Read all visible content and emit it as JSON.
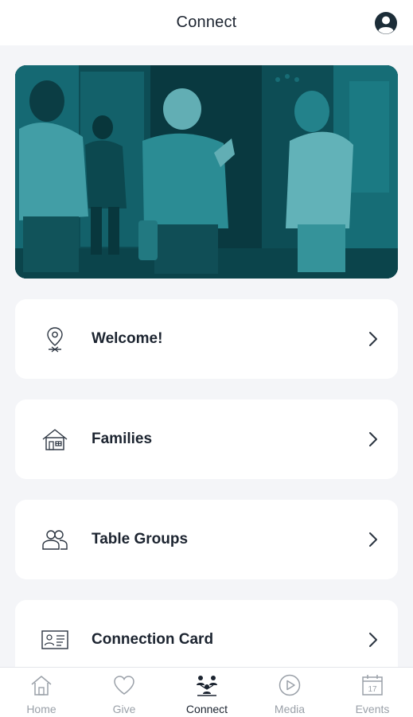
{
  "header": {
    "title": "Connect",
    "profile_icon": "user-circle-icon"
  },
  "hero": {
    "image": "people-greeting-at-church-entrance-photo",
    "tint": "#0e6f78"
  },
  "menu": [
    {
      "label": "Welcome!",
      "icon": "map-pin-icon"
    },
    {
      "label": "Families",
      "icon": "house-icon"
    },
    {
      "label": "Table Groups",
      "icon": "users-icon"
    },
    {
      "label": "Connection Card",
      "icon": "id-card-icon"
    }
  ],
  "tabs": [
    {
      "label": "Home",
      "icon": "home-icon",
      "active": false
    },
    {
      "label": "Give",
      "icon": "heart-icon",
      "active": false
    },
    {
      "label": "Connect",
      "icon": "connect-people-icon",
      "active": true
    },
    {
      "label": "Media",
      "icon": "play-circle-icon",
      "active": false
    },
    {
      "label": "Events",
      "icon": "calendar-icon",
      "active": false
    }
  ],
  "calendar_icon_text": "17",
  "colors": {
    "accent": "#1c2430",
    "inactive": "#9aa0a8",
    "background": "#f4f5f8",
    "hero_tint": "#0e6f78"
  }
}
